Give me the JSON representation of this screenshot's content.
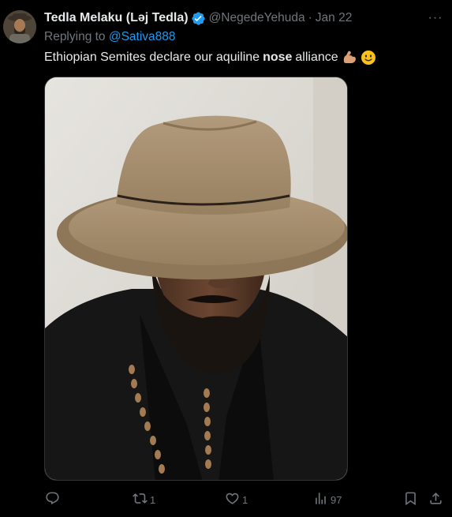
{
  "author": {
    "display_name": "Tedla Melaku (Ləj Tedla)",
    "handle": "@NegedeYehuda",
    "separator": "·",
    "date": "Jan 22",
    "verified": true
  },
  "more_label": "···",
  "reply": {
    "prefix": "Replying to",
    "mention": "@Sativa888"
  },
  "text": {
    "before": "Ethiopian Semites declare our aquiline",
    "bold": "nose",
    "after": "alliance",
    "emojis": [
      "flexed-biceps-emoji",
      "slightly-smiling-face-emoji"
    ]
  },
  "media": {
    "kind": "photo"
  },
  "actions": {
    "reply_count": "",
    "retweet_count": "1",
    "like_count": "1",
    "views_count": "97"
  },
  "colors": {
    "background": "#000000",
    "text": "#e7e9ea",
    "secondary": "#71767b",
    "accent": "#1d9bf0"
  }
}
